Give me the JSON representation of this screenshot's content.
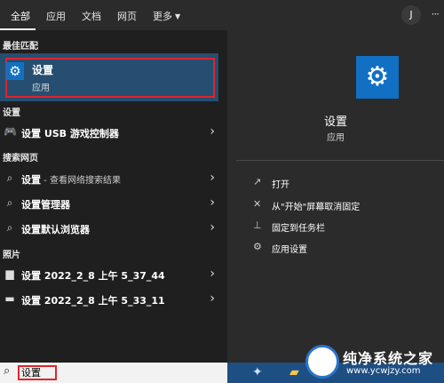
{
  "tabs": [
    {
      "label": "全部"
    },
    {
      "label": "应用"
    },
    {
      "label": "文档"
    },
    {
      "label": "网页"
    },
    {
      "label": "更多"
    }
  ],
  "user_initial": "J",
  "best_match": {
    "section": "最佳匹配",
    "title": "设置",
    "subtitle": "应用",
    "icon": "gear-icon"
  },
  "sections": {
    "settings": "设置",
    "web": "搜索网页",
    "photos": "照片"
  },
  "results": [
    {
      "label": "设置 USB 游戏控制器",
      "sub": "",
      "icon": "gamepad-icon"
    },
    {
      "label": "设置",
      "sub": " - 查看网络搜索结果",
      "icon": "search-icon"
    },
    {
      "label": "设置管理器",
      "sub": "",
      "icon": "search-icon"
    },
    {
      "label": "设置默认浏览器",
      "sub": "",
      "icon": "search-icon"
    },
    {
      "label": "设置 2022_2_8 上午 5_37_44",
      "sub": "",
      "icon": "image-icon"
    },
    {
      "label": "设置 2022_2_8 上午 5_33_11",
      "sub": "",
      "icon": "image-icon"
    }
  ],
  "preview": {
    "title": "设置",
    "subtitle": "应用"
  },
  "actions": [
    {
      "label": "打开",
      "icon": "open-icon"
    },
    {
      "label": "从\"开始\"屏幕取消固定",
      "icon": "unpin-icon"
    },
    {
      "label": "固定到任务栏",
      "icon": "pin-icon"
    },
    {
      "label": "应用设置",
      "icon": "gear-icon"
    }
  ],
  "search": {
    "value": "设置"
  },
  "watermark": {
    "line1": "纯净系统之家",
    "line2": "www.ycwjzy.com"
  },
  "colors": {
    "accent": "#1170c4",
    "selected_bg": "#264e71",
    "highlight_border": "#e0252b"
  }
}
